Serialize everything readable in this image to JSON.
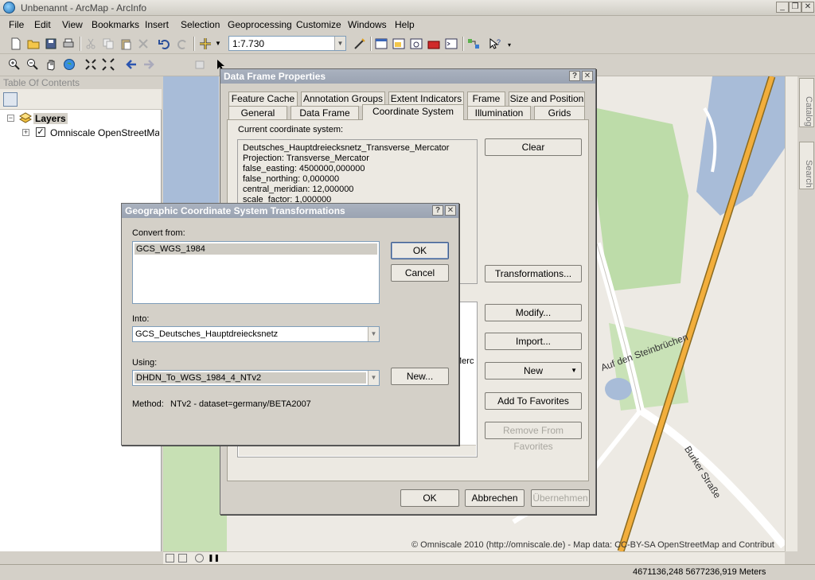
{
  "app": {
    "title": "Unbenannt - ArcMap - ArcInfo"
  },
  "menu": [
    "File",
    "Edit",
    "View",
    "Bookmarks",
    "Insert",
    "Selection",
    "Geoprocessing",
    "Customize",
    "Windows",
    "Help"
  ],
  "toolbar": {
    "scale": "1:7.730"
  },
  "toc": {
    "title": "Table Of Contents",
    "root_layer": "Layers",
    "layer_1": "Omniscale OpenStreetMap W"
  },
  "map": {
    "street_1": "Auf den Steinbrüchen",
    "street_2": "Burker Straße",
    "copyright": "© Omniscale 2010 (http://omniscale.de) - Map data: CC-BY-SA OpenStreetMap and Contribut"
  },
  "side_tabs": {
    "catalog": "Catalog",
    "search": "Search"
  },
  "status": {
    "coordinates": "4671136,248  5677236,919 Meters"
  },
  "dfp": {
    "title": "Data Frame Properties",
    "tabs_row1": [
      "Feature Cache",
      "Annotation Groups",
      "Extent Indicators",
      "Frame",
      "Size and Position"
    ],
    "tabs_row2": [
      "General",
      "Data Frame",
      "Coordinate System",
      "Illumination",
      "Grids"
    ],
    "current_label": "Current coordinate system:",
    "coord_lines": [
      "Deutsches_Hauptdreiecksnetz_Transverse_Mercator",
      "Projection: Transverse_Mercator",
      "false_easting: 4500000,000000",
      "false_northing: 0,000000",
      "central_meridian: 12,000000",
      "scale_factor: 1,000000"
    ],
    "tree_partial": "Merc",
    "buttons": {
      "clear": "Clear",
      "transformations": "Transformations...",
      "modify": "Modify...",
      "import": "Import...",
      "new": "New",
      "add_fav": "Add To Favorites",
      "remove_fav": "Remove From Favorites"
    },
    "footer": {
      "ok": "OK",
      "cancel": "Abbrechen",
      "apply": "Übernehmen"
    }
  },
  "gcs": {
    "title": "Geographic Coordinate System Transformations",
    "convert_from_label": "Convert from:",
    "convert_from_item": "GCS_WGS_1984",
    "into_label": "Into:",
    "into_value": "GCS_Deutsches_Hauptdreiecksnetz",
    "using_label": "Using:",
    "using_value": "DHDN_To_WGS_1984_4_NTv2",
    "method_label": "Method:",
    "method_value": "NTv2 - dataset=germany/BETA2007",
    "buttons": {
      "ok": "OK",
      "cancel": "Cancel",
      "new": "New..."
    }
  }
}
